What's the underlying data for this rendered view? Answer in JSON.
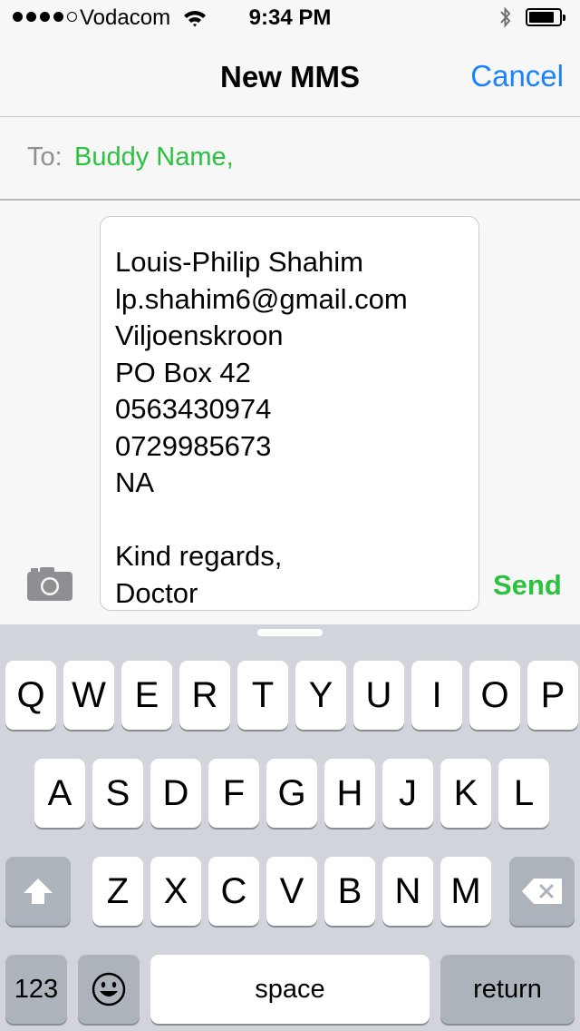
{
  "status_bar": {
    "carrier": "Vodacom",
    "time": "9:34 PM",
    "signal_bars_filled": 4,
    "signal_bars_total": 5,
    "battery_level": 0.85
  },
  "nav": {
    "title": "New MMS",
    "cancel_label": "Cancel"
  },
  "recipient": {
    "label": "To:",
    "value": "Buddy Name,"
  },
  "message": {
    "lines": [
      "Louis-Philip Shahim",
      "lp.shahim6@gmail.com",
      "Viljoenskroon",
      "PO Box 42",
      "0563430974",
      "0729985673",
      "NA",
      "",
      "Kind regards,",
      "Doctor"
    ]
  },
  "send_label": "Send",
  "keyboard": {
    "row1": [
      "Q",
      "W",
      "E",
      "R",
      "T",
      "Y",
      "U",
      "I",
      "O",
      "P"
    ],
    "row2": [
      "A",
      "S",
      "D",
      "F",
      "G",
      "H",
      "J",
      "K",
      "L"
    ],
    "row3": [
      "Z",
      "X",
      "C",
      "V",
      "B",
      "N",
      "M"
    ],
    "numbers_label": "123",
    "space_label": "space",
    "return_label": "return"
  },
  "colors": {
    "accent_blue": "#1a82fb",
    "accent_green": "#2bc240",
    "keyboard_bg": "#d1d5db"
  }
}
